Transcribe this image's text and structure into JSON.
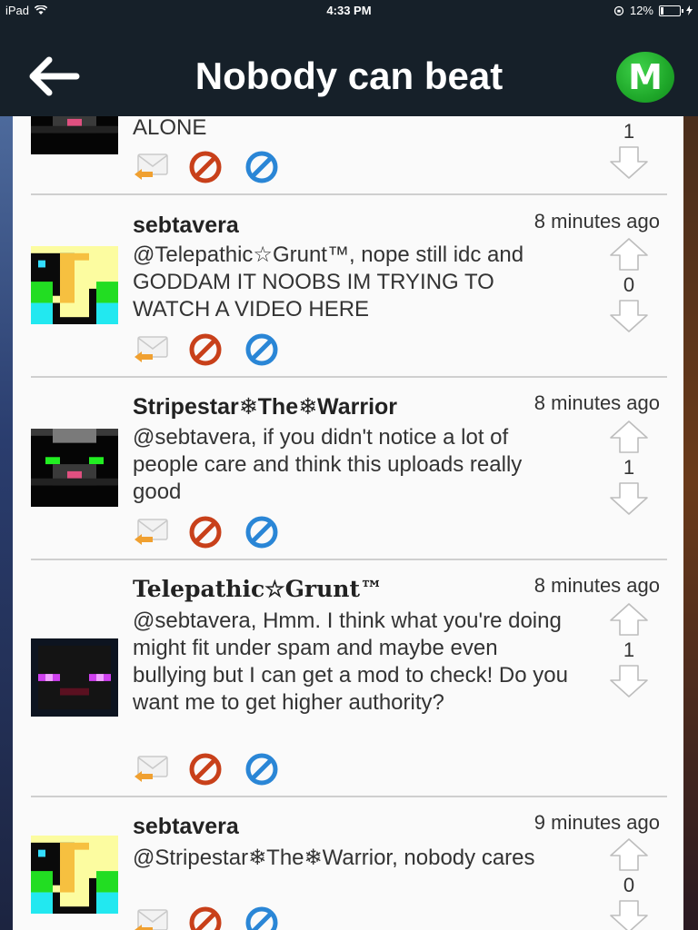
{
  "status_bar": {
    "device": "iPad",
    "time": "4:33 PM",
    "battery": "12%"
  },
  "nav": {
    "title": "Nobody can beat",
    "badge": "M"
  },
  "comments": [
    {
      "username": "",
      "time": "",
      "text": "ALONE",
      "score": "1"
    },
    {
      "username": "sebtavera",
      "time": "8 minutes ago",
      "text": "@Telepathic☆Grunt™, nope still idc and GODDAM IT NOOBS IM TRYING TO WATCH A VIDEO HERE",
      "score": "0"
    },
    {
      "username": "Stripestar❄The❄Warrior",
      "time": "8 minutes ago",
      "text": "@sebtavera, if you didn't notice a lot of people care and think this uploads really good",
      "score": "1"
    },
    {
      "username": "Telepathic☆Grunt™",
      "time": "8 minutes ago",
      "text": "@sebtavera, Hmm. I think what you're doing might fit under spam and maybe even bullying but I can get a mod to check! Do you want me to get higher authority?",
      "score": "1"
    },
    {
      "username": "sebtavera",
      "time": "9 minutes ago",
      "text": "@Stripestar❄The❄Warrior, nobody cares",
      "score": "0"
    }
  ],
  "colors": {
    "navbar": "#162029",
    "badge": "#1fa82a",
    "block_icon": "#c8401a",
    "flag_icon": "#2a86d6",
    "reply_icon": "#f0a030"
  }
}
